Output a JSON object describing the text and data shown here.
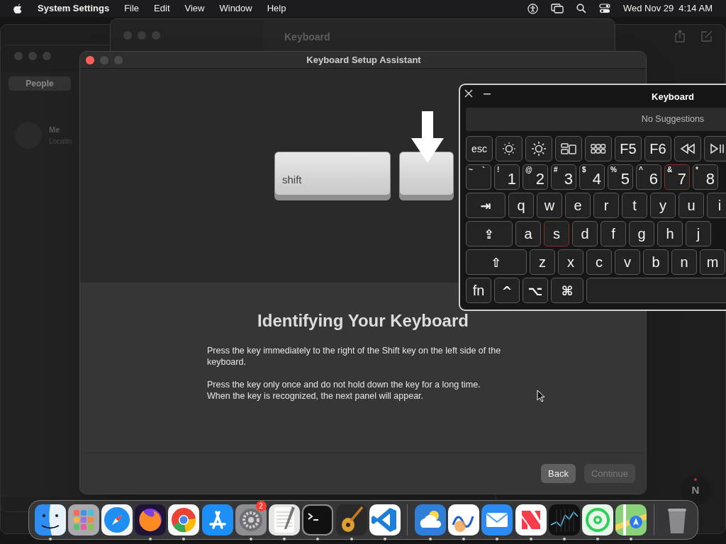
{
  "menu_bar": {
    "app_name": "System Settings",
    "menus": [
      "File",
      "Edit",
      "View",
      "Window",
      "Help"
    ],
    "date": "Wed Nov 29",
    "time": "4:14 AM"
  },
  "background": {
    "settings_window": {
      "title": "Keyboard"
    },
    "contacts_window": {
      "tab": "People",
      "name": "Me",
      "status": "Locatin"
    },
    "map": {
      "compass": "N"
    }
  },
  "assistant": {
    "title": "Keyboard Setup Assistant",
    "illustration": {
      "key_label": "shift"
    },
    "heading": "Identifying Your Keyboard",
    "paragraphs": [
      [
        "Press the key immediately to the right of the Shift key on the left side of the keyboard."
      ],
      [
        "Press the key only once and do not hold down the key for a long time.",
        "When the key is recognized, the next panel will appear."
      ]
    ],
    "buttons": [
      {
        "label": "Back",
        "disabled": false
      },
      {
        "label": "Continue",
        "disabled": true
      }
    ]
  },
  "keyboard_viewer": {
    "title": "Keyboard",
    "suggestions": "No Suggestions",
    "key_lines": [
      [
        {
          "kind": "key",
          "label": "esc",
          "highlighted": false
        },
        {
          "kind": "icon",
          "highlighted": false
        },
        {
          "kind": "icon",
          "highlighted": false
        },
        {
          "kind": "icon",
          "highlighted": false
        },
        {
          "kind": "icon",
          "highlighted": false
        },
        {
          "kind": "key",
          "label": "F5",
          "highlighted": false
        },
        {
          "kind": "key",
          "label": "F6",
          "highlighted": false
        },
        {
          "kind": "icon",
          "highlighted": false
        },
        {
          "kind": "icon",
          "highlighted": false
        }
      ],
      [
        {
          "kind": "pair",
          "label": "`",
          "shift": "~",
          "highlighted": false
        },
        {
          "kind": "dual",
          "label": "1",
          "shift": "!",
          "highlighted": false
        },
        {
          "kind": "dual",
          "label": "2",
          "shift": "@",
          "highlighted": false
        },
        {
          "kind": "dual",
          "label": "3",
          "shift": "#",
          "highlighted": false
        },
        {
          "kind": "dual",
          "label": "4",
          "shift": "$",
          "highlighted": false
        },
        {
          "kind": "dual",
          "label": "5",
          "shift": "%",
          "highlighted": false
        },
        {
          "kind": "dual",
          "label": "6",
          "shift": "^",
          "highlighted": false
        },
        {
          "kind": "dual",
          "label": "7",
          "shift": "&",
          "highlighted": true
        },
        {
          "kind": "dual",
          "label": "8",
          "shift": "*",
          "highlighted": false
        }
      ],
      [
        {
          "kind": "symbol",
          "label": "⇥",
          "highlighted": false
        },
        {
          "kind": "key",
          "label": "q",
          "highlighted": false
        },
        {
          "kind": "key",
          "label": "w",
          "highlighted": false
        },
        {
          "kind": "key",
          "label": "e",
          "highlighted": false
        },
        {
          "kind": "key",
          "label": "r",
          "highlighted": false
        },
        {
          "kind": "key",
          "label": "t",
          "highlighted": false
        },
        {
          "kind": "key",
          "label": "y",
          "highlighted": false
        },
        {
          "kind": "key",
          "label": "u",
          "highlighted": false
        },
        {
          "kind": "key",
          "label": "i",
          "highlighted": false
        }
      ],
      [
        {
          "kind": "symbol",
          "label": "⇪",
          "highlighted": false
        },
        {
          "kind": "key",
          "label": "a",
          "highlighted": false
        },
        {
          "kind": "key",
          "label": "s",
          "highlighted": true
        },
        {
          "kind": "key",
          "label": "d",
          "highlighted": false
        },
        {
          "kind": "key",
          "label": "f",
          "highlighted": false
        },
        {
          "kind": "key",
          "label": "g",
          "highlighted": false
        },
        {
          "kind": "key",
          "label": "h",
          "highlighted": false
        },
        {
          "kind": "key",
          "label": "j",
          "highlighted": false
        }
      ],
      [
        {
          "kind": "symbol",
          "label": "⇧",
          "highlighted": false
        },
        {
          "kind": "key",
          "label": "z",
          "highlighted": false
        },
        {
          "kind": "key",
          "label": "x",
          "highlighted": false
        },
        {
          "kind": "key",
          "label": "c",
          "highlighted": false
        },
        {
          "kind": "key",
          "label": "v",
          "highlighted": false
        },
        {
          "kind": "key",
          "label": "b",
          "highlighted": false
        },
        {
          "kind": "key",
          "label": "n",
          "highlighted": false
        },
        {
          "kind": "key",
          "label": "m",
          "highlighted": false
        }
      ],
      [
        {
          "kind": "key",
          "label": "fn",
          "highlighted": false
        },
        {
          "kind": "symbol",
          "label": "^",
          "highlighted": false
        },
        {
          "kind": "symbol",
          "label": "⌥",
          "highlighted": false
        },
        {
          "kind": "symbol",
          "label": "⌘",
          "highlighted": false
        },
        {
          "kind": "space",
          "highlighted": false
        }
      ]
    ]
  },
  "dock": {
    "groups": [
      [
        {
          "running": true
        },
        {
          "running": false
        },
        {
          "running": false
        },
        {
          "running": true
        },
        {
          "running": true
        },
        {
          "running": false
        },
        {
          "running": true,
          "badge": "2"
        },
        {
          "running": true
        },
        {
          "running": true
        },
        {
          "running": true
        },
        {
          "running": true
        }
      ],
      [
        {
          "running": true
        },
        {
          "running": true
        },
        {
          "running": true
        },
        {
          "running": true
        },
        {
          "running": true
        },
        {
          "running": true
        },
        {
          "running": true
        }
      ],
      [
        {
          "running": false
        }
      ]
    ]
  }
}
